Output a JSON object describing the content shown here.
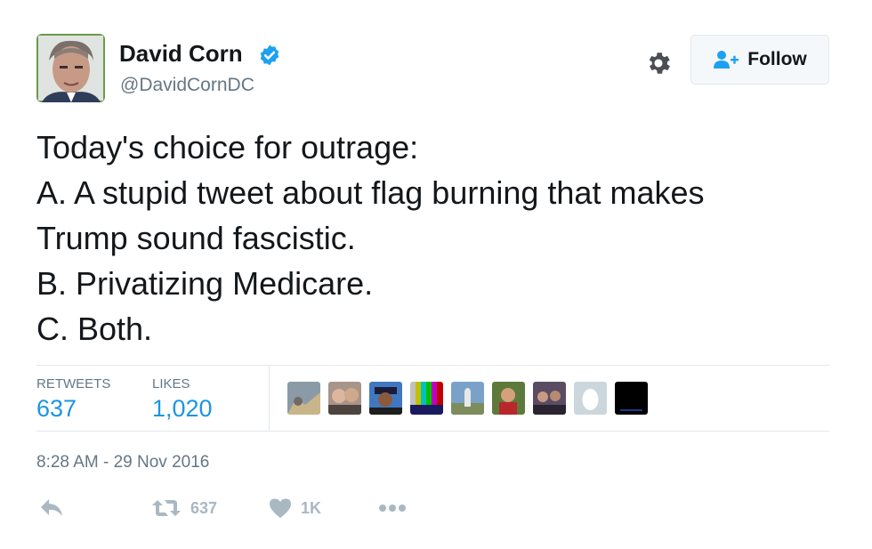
{
  "tweet": {
    "author": {
      "name": "David Corn",
      "handle": "@DavidCornDC",
      "verified": true
    },
    "follow_label": "Follow",
    "text_lines": [
      "Today's choice for outrage:",
      "A. A stupid tweet about flag burning that makes",
      "Trump sound fascistic.",
      "B. Privatizing Medicare.",
      "C. Both."
    ],
    "stats": {
      "retweets_label": "RETWEETS",
      "retweets_value": "637",
      "likes_label": "LIKES",
      "likes_value": "1,020"
    },
    "timestamp": "8:28 AM - 29 Nov 2016",
    "actions": {
      "reply_icon": "reply-icon",
      "retweet_count": "637",
      "like_count": "1K",
      "more_icon": "more-icon"
    }
  },
  "colors": {
    "link_blue": "#1b95e0",
    "verified_blue": "#1da1f2",
    "muted_gray": "#657786",
    "icon_gray": "#aab8c2",
    "text_dark": "#14171a"
  }
}
